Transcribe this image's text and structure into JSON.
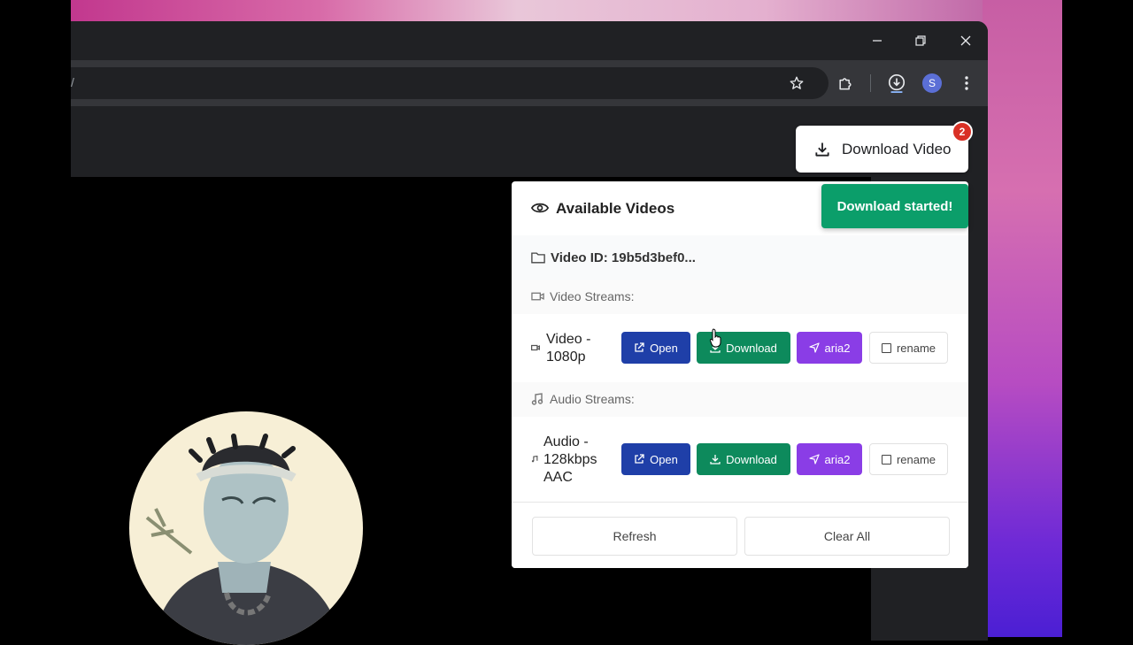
{
  "browser": {
    "omnibox_text": "/",
    "avatar_letter": "S"
  },
  "extension_button": {
    "label": "Download Video",
    "badge_count": "2"
  },
  "toast": {
    "text": "Download started!"
  },
  "panel": {
    "title": "Available Videos",
    "video_id": "Video ID: 19b5d3bef0...",
    "video_section_label": "Video Streams:",
    "audio_section_label": "Audio Streams:",
    "video_streams": [
      {
        "line1": "Video -",
        "line2": "1080p",
        "line3": ""
      }
    ],
    "audio_streams": [
      {
        "line1": "Audio -",
        "line2": "128kbps",
        "line3": "AAC"
      }
    ],
    "buttons": {
      "open": "Open",
      "download": "Download",
      "aria2": "aria2",
      "rename": "rename"
    },
    "footer": {
      "refresh": "Refresh",
      "clear_all": "Clear All"
    }
  },
  "colors": {
    "open": "#1f3fa8",
    "download": "#0d8a5c",
    "aria2": "#8a3de6",
    "toast": "#0b9e6a",
    "badge": "#d93025"
  }
}
